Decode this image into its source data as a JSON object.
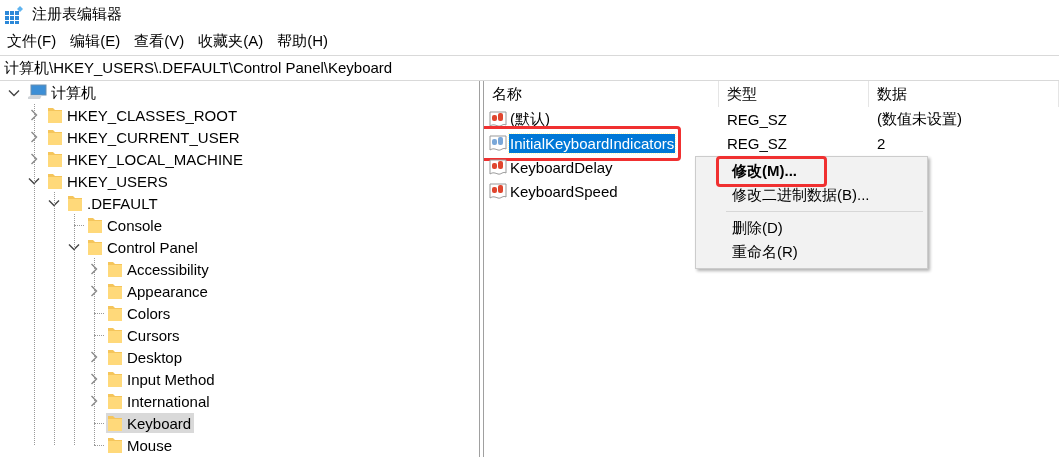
{
  "window": {
    "title": "注册表编辑器"
  },
  "menu_bar": [
    "文件(F)",
    "编辑(E)",
    "查看(V)",
    "收藏夹(A)",
    "帮助(H)"
  ],
  "address_bar": {
    "value": "计算机\\HKEY_USERS\\.DEFAULT\\Control Panel\\Keyboard"
  },
  "tree": {
    "label": "计算机",
    "kind": "computer",
    "expanded": true,
    "selected": false,
    "children": [
      {
        "label": "HKEY_CLASSES_ROOT",
        "kind": "folder",
        "expanded": false,
        "selected": false
      },
      {
        "label": "HKEY_CURRENT_USER",
        "kind": "folder",
        "expanded": false,
        "selected": false
      },
      {
        "label": "HKEY_LOCAL_MACHINE",
        "kind": "folder",
        "expanded": false,
        "selected": false
      },
      {
        "label": "HKEY_USERS",
        "kind": "folder",
        "expanded": true,
        "selected": false,
        "children": [
          {
            "label": ".DEFAULT",
            "kind": "folder",
            "expanded": true,
            "selected": false,
            "children": [
              {
                "label": "Console",
                "kind": "folder",
                "selected": false
              },
              {
                "label": "Control Panel",
                "kind": "folder",
                "expanded": true,
                "selected": false,
                "children": [
                  {
                    "label": "Accessibility",
                    "kind": "folder",
                    "expanded": false,
                    "selected": false
                  },
                  {
                    "label": "Appearance",
                    "kind": "folder",
                    "expanded": false,
                    "selected": false
                  },
                  {
                    "label": "Colors",
                    "kind": "folder",
                    "selected": false
                  },
                  {
                    "label": "Cursors",
                    "kind": "folder",
                    "selected": false
                  },
                  {
                    "label": "Desktop",
                    "kind": "folder",
                    "expanded": false,
                    "selected": false
                  },
                  {
                    "label": "Input Method",
                    "kind": "folder",
                    "expanded": false,
                    "selected": false
                  },
                  {
                    "label": "International",
                    "kind": "folder",
                    "expanded": false,
                    "selected": false
                  },
                  {
                    "label": "Keyboard",
                    "kind": "folder",
                    "selected": true
                  },
                  {
                    "label": "Mouse",
                    "kind": "folder",
                    "selected": false
                  }
                ]
              }
            ]
          }
        ]
      }
    ]
  },
  "values": {
    "columns": [
      "名称",
      "类型",
      "数据"
    ],
    "rows": [
      {
        "name": "(默认)",
        "type": "REG_SZ",
        "data": "(数值未设置)",
        "selected": false,
        "annotated": false
      },
      {
        "name": "InitialKeyboardIndicators",
        "type": "REG_SZ",
        "data": "2",
        "selected": true,
        "annotated": true
      },
      {
        "name": "KeyboardDelay",
        "selected": false,
        "annotated": false
      },
      {
        "name": "KeyboardSpeed",
        "selected": false,
        "annotated": false
      }
    ]
  },
  "context_menu": {
    "items": [
      {
        "kind": "item",
        "label": "修改(M)...",
        "default": true,
        "annotated": true
      },
      {
        "kind": "item",
        "label": "修改二进制数据(B)...",
        "default": false,
        "annotated": false
      },
      {
        "kind": "separator"
      },
      {
        "kind": "item",
        "label": "删除(D)",
        "default": false,
        "annotated": false
      },
      {
        "kind": "item",
        "label": "重命名(R)",
        "default": false,
        "annotated": false
      }
    ]
  }
}
